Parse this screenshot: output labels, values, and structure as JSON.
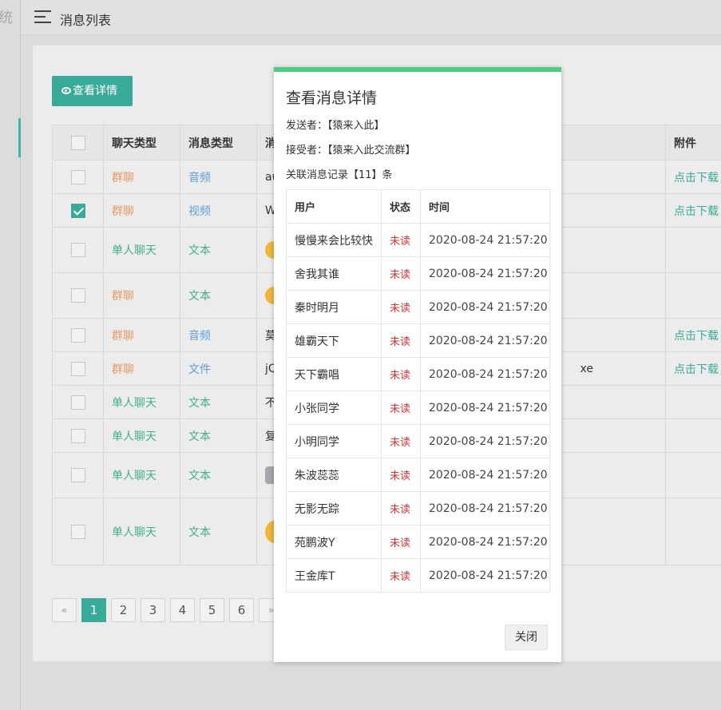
{
  "sidebar": {
    "brand_fragment": "统"
  },
  "header": {
    "title": "消息列表"
  },
  "toolbar": {
    "view_details": "查看详情"
  },
  "table": {
    "columns": [
      "聊天类型",
      "消息类型",
      "消",
      "附件"
    ],
    "rows": [
      {
        "checked": false,
        "chat_type": "群聊",
        "chat_class": "group",
        "msg_type": "音频",
        "msg_class": "msg",
        "content": "au",
        "content_kind": "text",
        "extra": "",
        "attachment": "点击下载"
      },
      {
        "checked": true,
        "chat_type": "群聊",
        "chat_class": "group",
        "msg_type": "视频",
        "msg_class": "msg",
        "content": "W",
        "content_kind": "text",
        "extra": "",
        "attachment": "点击下载"
      },
      {
        "checked": false,
        "chat_type": "单人聊天",
        "chat_class": "single",
        "msg_type": "文本",
        "msg_class": "text",
        "content": "",
        "content_kind": "emoji",
        "extra": "",
        "attachment": ""
      },
      {
        "checked": false,
        "chat_type": "群聊",
        "chat_class": "group",
        "msg_type": "文本",
        "msg_class": "text",
        "content": "",
        "content_kind": "emoji",
        "extra": "",
        "attachment": ""
      },
      {
        "checked": false,
        "chat_type": "群聊",
        "chat_class": "group",
        "msg_type": "音频",
        "msg_class": "msg",
        "content": "莫",
        "content_kind": "text",
        "extra": "",
        "attachment": "点击下载"
      },
      {
        "checked": false,
        "chat_type": "群聊",
        "chat_class": "group",
        "msg_type": "文件",
        "msg_class": "msg",
        "content": "jQ",
        "content_kind": "text",
        "extra": "xe",
        "attachment": "点击下载"
      },
      {
        "checked": false,
        "chat_type": "单人聊天",
        "chat_class": "single",
        "msg_type": "文本",
        "msg_class": "text",
        "content": "不",
        "content_kind": "text",
        "extra": "",
        "attachment": ""
      },
      {
        "checked": false,
        "chat_type": "单人聊天",
        "chat_class": "single",
        "msg_type": "文本",
        "msg_class": "text",
        "content": "复",
        "content_kind": "text",
        "extra": "",
        "attachment": ""
      },
      {
        "checked": false,
        "chat_type": "单人聊天",
        "chat_class": "single",
        "msg_type": "文本",
        "msg_class": "text",
        "content": "",
        "content_kind": "image",
        "extra": "",
        "attachment": ""
      },
      {
        "checked": false,
        "chat_type": "单人聊天",
        "chat_class": "single",
        "msg_type": "文本",
        "msg_class": "text",
        "content": "",
        "content_kind": "emoji-big",
        "extra": "",
        "attachment": ""
      }
    ]
  },
  "pagination": {
    "prev": "«",
    "pages": [
      "1",
      "2",
      "3",
      "4",
      "5",
      "6"
    ],
    "current": "1",
    "next": "»"
  },
  "modal": {
    "title": "查看消息详情",
    "sender": "发送者：【猿来入此】",
    "receiver": "接受者：【猿来入此交流群】",
    "related": "关联消息记录【11】条",
    "columns": [
      "用户",
      "状态",
      "时间"
    ],
    "records": [
      {
        "user": "慢慢来会比较快",
        "status": "未读",
        "time": "2020-08-24 21:57:20"
      },
      {
        "user": "舍我其谁",
        "status": "未读",
        "time": "2020-08-24 21:57:20"
      },
      {
        "user": "秦时明月",
        "status": "未读",
        "time": "2020-08-24 21:57:20"
      },
      {
        "user": "雄霸天下",
        "status": "未读",
        "time": "2020-08-24 21:57:20"
      },
      {
        "user": "天下霸唱",
        "status": "未读",
        "time": "2020-08-24 21:57:20"
      },
      {
        "user": "小张同学",
        "status": "未读",
        "time": "2020-08-24 21:57:20"
      },
      {
        "user": "小明同学",
        "status": "未读",
        "time": "2020-08-24 21:57:20"
      },
      {
        "user": "朱波蕊蕊",
        "status": "未读",
        "time": "2020-08-24 21:57:20"
      },
      {
        "user": "无影无踪",
        "status": "未读",
        "time": "2020-08-24 21:57:20"
      },
      {
        "user": "苑鹏波Y",
        "status": "未读",
        "time": "2020-08-24 21:57:20"
      },
      {
        "user": "王金库T",
        "status": "未读",
        "time": "2020-08-24 21:57:20"
      }
    ],
    "close": "关闭"
  }
}
